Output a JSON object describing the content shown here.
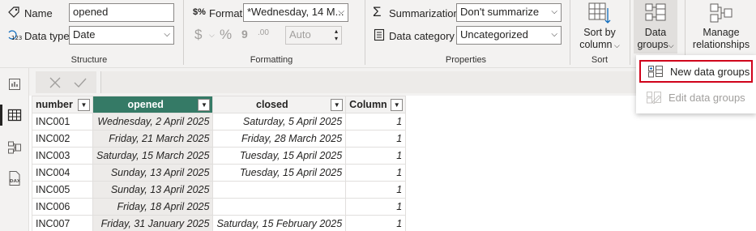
{
  "ribbon": {
    "structure": {
      "name_label": "Name",
      "name_value": "opened",
      "datatype_label": "Data type",
      "datatype_value": "Date",
      "group_label": "Structure"
    },
    "formatting": {
      "format_label": "Format",
      "format_value": "*Wednesday, 14 M...",
      "currency_symbol": "$",
      "percent_symbol": "%",
      "comma_symbol": "9",
      "decimal_symbol": ".00",
      "decimals_value": "Auto",
      "group_label": "Formatting"
    },
    "properties": {
      "summarization_label": "Summarization",
      "summarization_value": "Don't summarize",
      "category_label": "Data category",
      "category_value": "Uncategorized",
      "group_label": "Properties"
    },
    "sort": {
      "button_line1": "Sort by",
      "button_line2": "column",
      "group_label": "Sort"
    },
    "data_groups": {
      "line1": "Data",
      "line2": "groups"
    },
    "relationships": {
      "line1": "Manage",
      "line2": "relationships"
    }
  },
  "menu": {
    "new_data_groups": "New data groups",
    "edit_data_groups": "Edit data groups"
  },
  "table": {
    "columns": [
      "number",
      "opened",
      "closed",
      "Column"
    ],
    "rows": [
      [
        "INC001",
        "Wednesday, 2 April 2025",
        "Saturday, 5 April 2025",
        "1"
      ],
      [
        "INC002",
        "Friday, 21 March 2025",
        "Friday, 28 March 2025",
        "1"
      ],
      [
        "INC003",
        "Saturday, 15 March 2025",
        "Tuesday, 15 April 2025",
        "1"
      ],
      [
        "INC004",
        "Sunday, 13 April 2025",
        "Tuesday, 15 April 2025",
        "1"
      ],
      [
        "INC005",
        "Sunday, 13 April 2025",
        "",
        "1"
      ],
      [
        "INC006",
        "Friday, 18 April 2025",
        "",
        "1"
      ],
      [
        "INC007",
        "Friday, 31 January 2025",
        "Saturday, 15 February 2025",
        "1"
      ]
    ]
  },
  "colors": {
    "selected_header": "#357a66",
    "highlight_border": "#d0021b"
  }
}
